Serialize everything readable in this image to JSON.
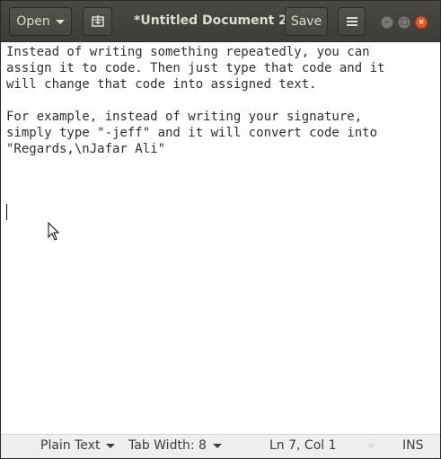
{
  "header": {
    "open_label": "Open",
    "title": "*Untitled Document 2",
    "save_label": "Save",
    "new_tab_icon": "new-document-icon",
    "menu_icon": "hamburger-menu-icon"
  },
  "window_controls": {
    "minimize_icon": "minimize-icon",
    "maximize_icon": "maximize-icon",
    "close_icon": "close-icon"
  },
  "editor": {
    "lines": [
      "Instead of writing something repeatedly, you can",
      "assign it to code. Then just type that code and it",
      "will change that code into assigned text.",
      "",
      "For example, instead of writing your signature,",
      "simply type \"-jeff\" and it will convert code into",
      "\"Regards,\\nJafar Ali\""
    ]
  },
  "statusbar": {
    "language": "Plain Text",
    "tab_width": "Tab Width: 8",
    "position": "Ln 7, Col 1",
    "mode": "INS"
  },
  "colors": {
    "header_bg": "#3d3c38",
    "close_button": "#e9541f",
    "editor_bg": "#ffffff",
    "statusbar_bg": "#f0efed"
  }
}
